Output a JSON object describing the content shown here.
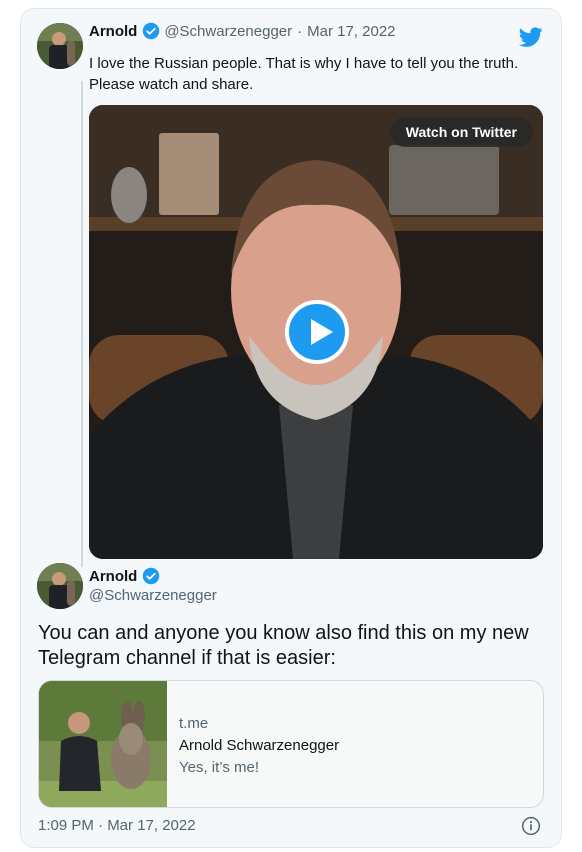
{
  "tweet1": {
    "name": "Arnold",
    "handle": "@Schwarzenegger",
    "separator": "·",
    "date": "Mar 17, 2022",
    "text": "I love the Russian people. That is why I have to tell you the truth. Please watch and share.",
    "video": {
      "watch_label": "Watch on Twitter"
    }
  },
  "tweet2": {
    "name": "Arnold",
    "handle": "@Schwarzenegger",
    "text": "You can and anyone you know also find this on my new Telegram channel if that is easier:",
    "link_card": {
      "domain": "t.me",
      "title": "Arnold Schwarzenegger",
      "description": "Yes, it’s me!"
    },
    "timestamp": "1:09 PM · Mar 17, 2022"
  },
  "icons": {
    "brand": "twitter-bird-icon",
    "verified": "verified-badge-icon",
    "play": "play-icon",
    "info": "info-icon"
  },
  "colors": {
    "accent": "#1d9bf0",
    "text": "#0f1419",
    "muted": "#536471",
    "border": "#cfd9de",
    "background": "#f5f8fa"
  }
}
